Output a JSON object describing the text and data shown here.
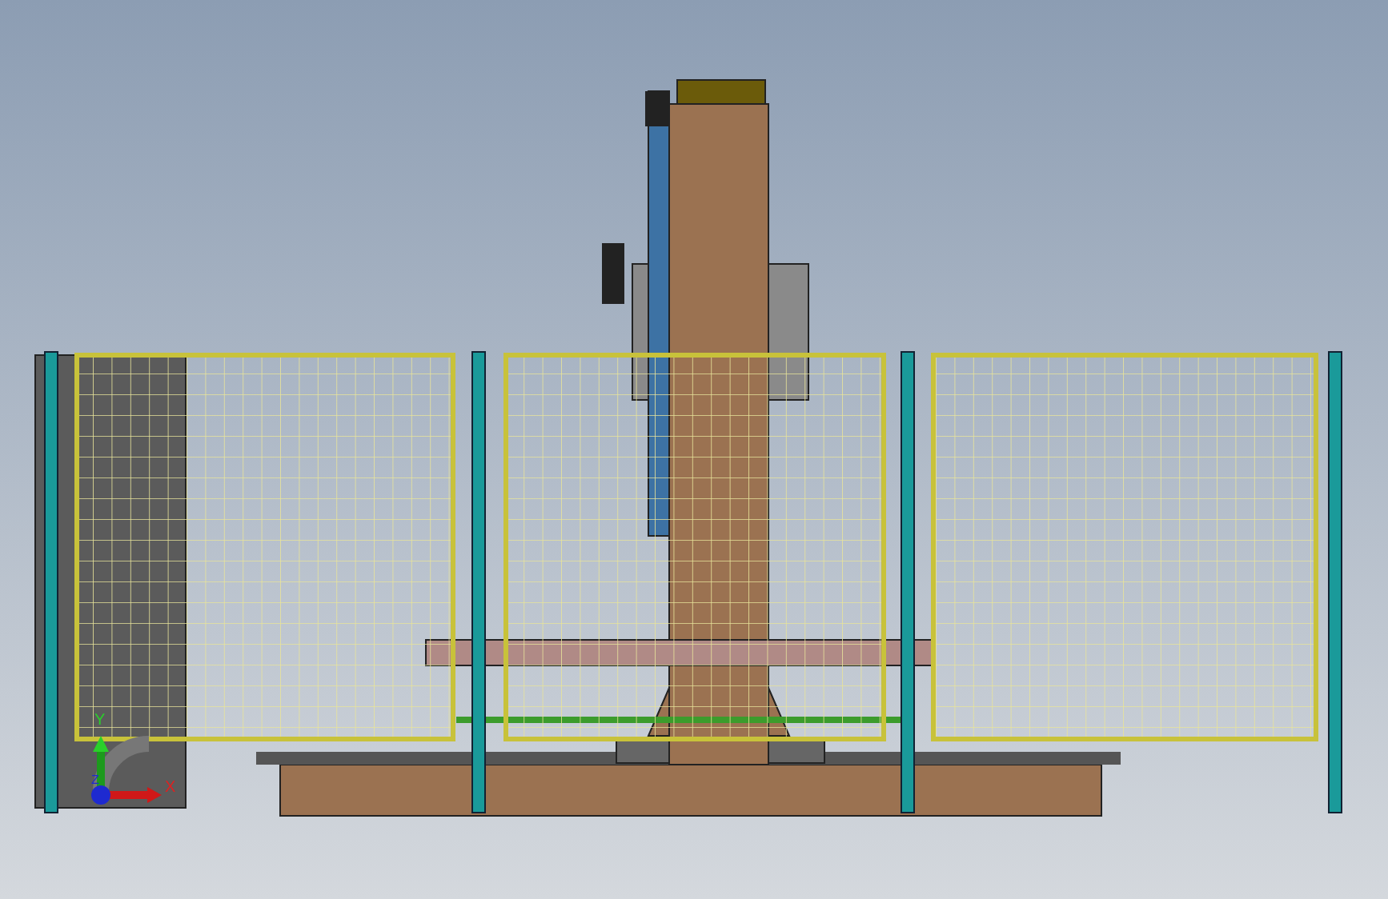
{
  "viewport": {
    "triad": {
      "x_label": "X",
      "y_label": "Y",
      "z_label": "Z"
    }
  }
}
